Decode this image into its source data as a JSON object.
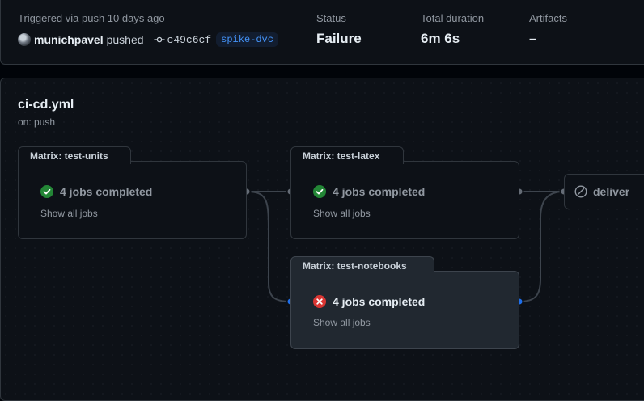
{
  "run": {
    "trigger_text": "Triggered via push 10 days ago",
    "actor": "munichpavel",
    "action": "pushed",
    "commit_sha": "c49c6cf",
    "branch": "spike-dvc"
  },
  "stats": {
    "status_label": "Status",
    "status_value": "Failure",
    "duration_label": "Total duration",
    "duration_value": "6m 6s",
    "artifacts_label": "Artifacts",
    "artifacts_value": "–"
  },
  "workflow": {
    "file": "ci-cd.yml",
    "trigger": "on: push"
  },
  "jobs": {
    "test_units": {
      "title": "Matrix: test-units",
      "status": "success",
      "summary": "4 jobs completed",
      "show_all": "Show all jobs"
    },
    "test_latex": {
      "title": "Matrix: test-latex",
      "status": "success",
      "summary": "4 jobs completed",
      "show_all": "Show all jobs"
    },
    "test_notebooks": {
      "title": "Matrix: test-notebooks",
      "status": "failure",
      "summary": "4 jobs completed",
      "show_all": "Show all jobs"
    },
    "deliver": {
      "title": "deliver",
      "status": "skipped"
    }
  },
  "colors": {
    "success": "#238636",
    "failure": "#da3633",
    "link_blue": "#1f6feb",
    "edge": "#3d444d",
    "node": "#656c76"
  },
  "icons": {
    "success": "check-circle-fill-icon",
    "failure": "x-circle-fill-icon",
    "skipped": "skip-icon",
    "commit": "git-commit-icon"
  }
}
